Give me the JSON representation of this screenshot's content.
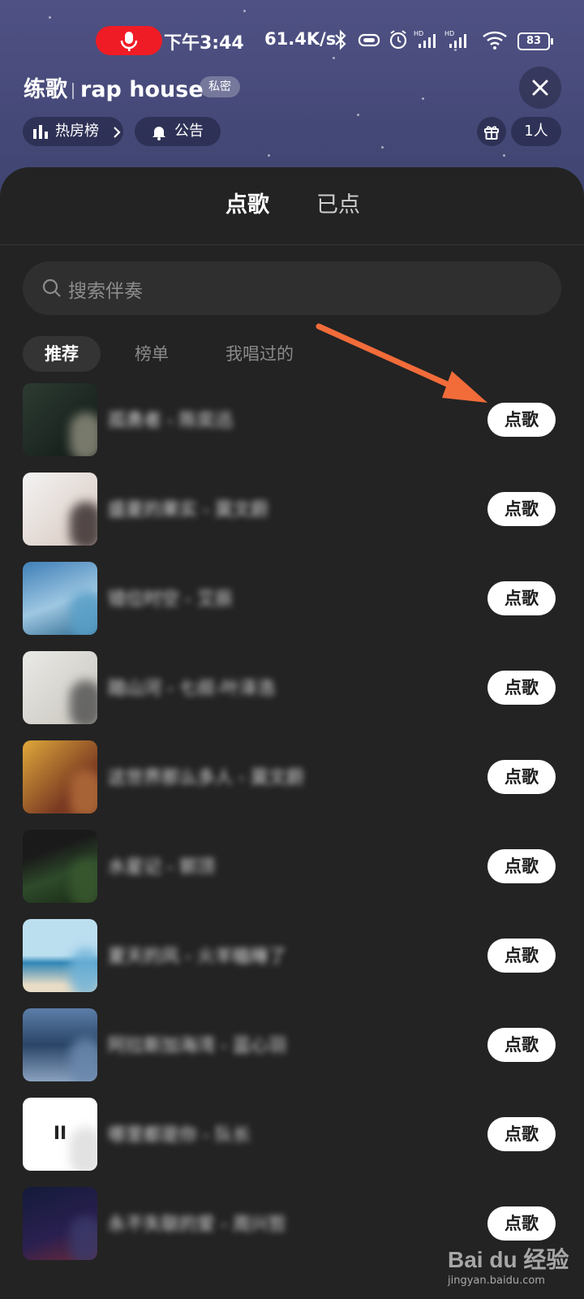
{
  "status_bar": {
    "time": "下午3:44",
    "net_speed": "61.4K/s",
    "battery": "83"
  },
  "room": {
    "title_prefix": "练歌",
    "title_name": "rap house",
    "privacy_badge": "私密",
    "hot_rank_label": "热房榜",
    "notice_label": "公告",
    "member_count": "1人"
  },
  "tabs": {
    "songs": "点歌",
    "ordered": "已点"
  },
  "search": {
    "placeholder": "搜索伴奏"
  },
  "subtabs": {
    "recommend": "推荐",
    "ranking": "榜单",
    "sung": "我唱过的"
  },
  "songs": [
    {
      "name": "孤勇者 - 陈奕迅",
      "button": "点歌"
    },
    {
      "name": "盛夏的果实 - 莫文蔚",
      "button": "点歌"
    },
    {
      "name": "错位时空 - 艾辰",
      "button": "点歌"
    },
    {
      "name": "踏山河 - 七叔-叶泽浩",
      "button": "点歌"
    },
    {
      "name": "这世界那么多人 - 莫文蔚",
      "button": "点歌"
    },
    {
      "name": "水星记 - 郭顶",
      "button": "点歌"
    },
    {
      "name": "夏天的风 - 火羊瞌睡了",
      "button": "点歌"
    },
    {
      "name": "阿拉斯加海湾 - 蓝心羽",
      "button": "点歌"
    },
    {
      "name": "哪里都是你 - 队长",
      "button": "点歌"
    },
    {
      "name": "永不失联的爱 - 周兴哲",
      "button": "点歌"
    }
  ],
  "colors": {
    "header_bg": "#4a4e7c",
    "sheet_bg": "#232323",
    "arrow": "#f26c3a",
    "record_pill": "#f01c25"
  },
  "watermark": {
    "logo": "Bai du 经验",
    "url": "jingyan.baidu.com"
  }
}
